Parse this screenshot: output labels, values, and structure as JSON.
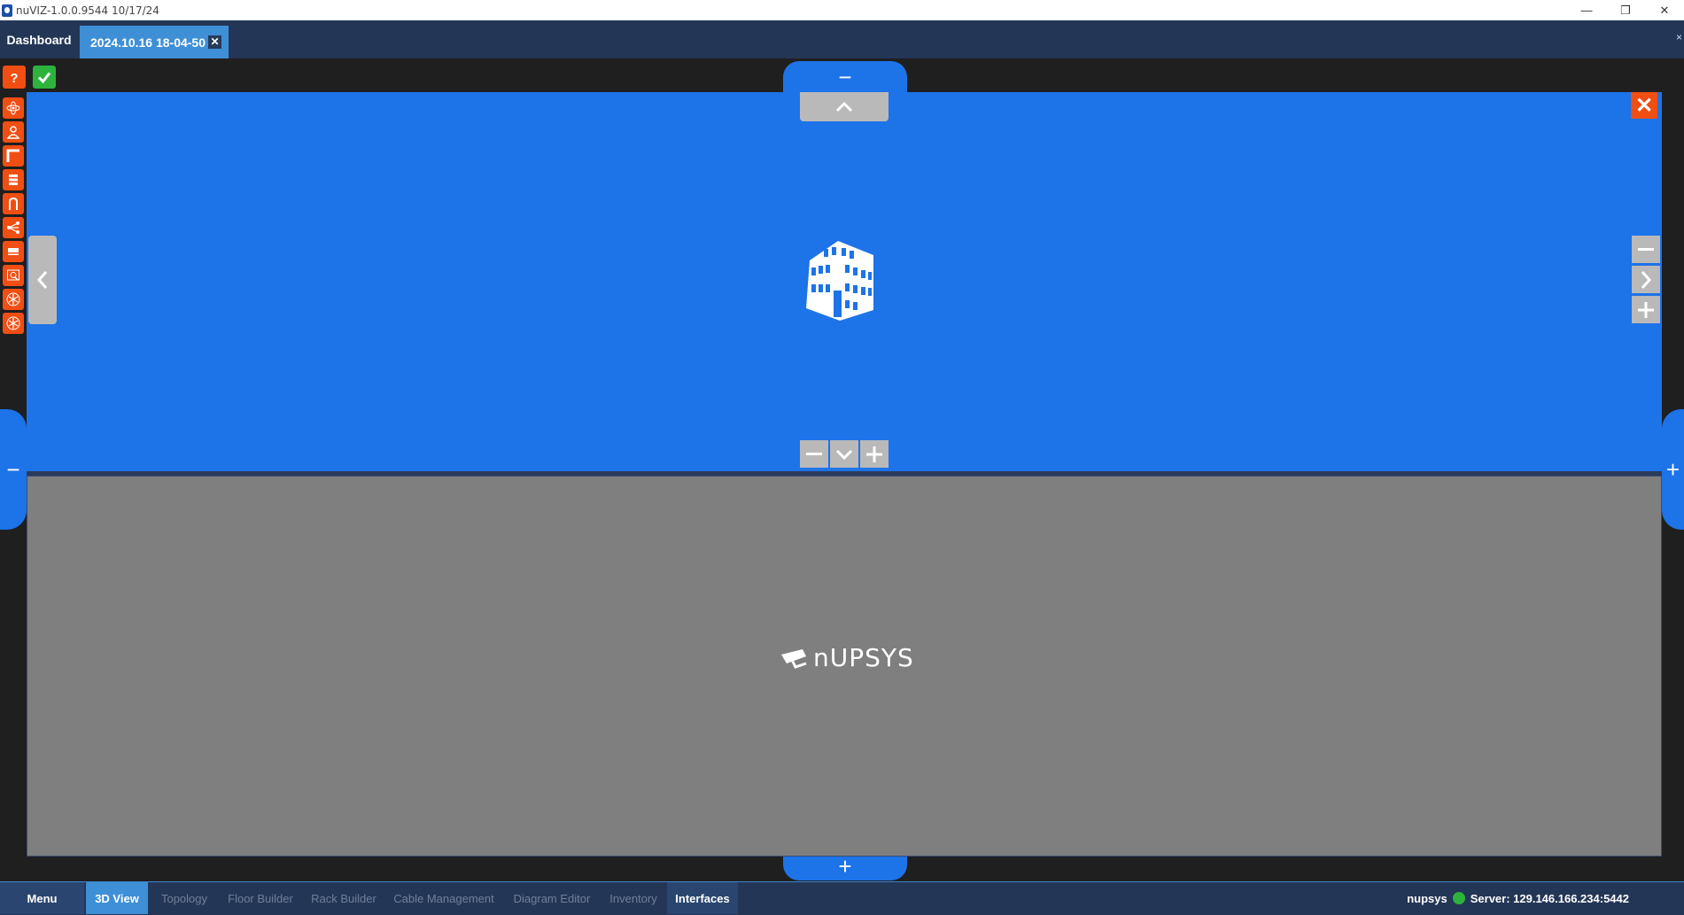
{
  "window": {
    "title": "nuVIZ-1.0.0.9544 10/17/24",
    "minimize_glyph": "—",
    "restore_glyph": "❐",
    "close_glyph": "✕"
  },
  "tabs": {
    "dashboard_label": "Dashboard",
    "session_label": "2024.10.16 18-04-50",
    "session_close": "✕",
    "overflow_glyph": "×"
  },
  "toolbar": {
    "help_icon": "question-icon",
    "check_icon": "check-icon",
    "tools": [
      "atom-icon",
      "user-icon",
      "frame-icon",
      "rack-icon",
      "cable-icon",
      "topology-icon",
      "tray-icon",
      "inspect-icon",
      "snowflake-icon",
      "snowflake-icon"
    ]
  },
  "panels": {
    "top_pill": "−",
    "bottom_pill": "+",
    "left_pill": "−",
    "right_pill": "+",
    "collapse_up": "^",
    "close_panel": "✕",
    "zoom_out": "−",
    "zoom_in": "+",
    "side_minus": "−",
    "side_next": "›",
    "side_plus": "+",
    "side_prev": "‹",
    "center_icon": "building-icon",
    "logo_text": "nUPSYS"
  },
  "bottom_nav": {
    "menu": "Menu",
    "items": [
      "3D View",
      "Topology",
      "Floor Builder",
      "Rack Builder",
      "Cable Management",
      "Diagram Editor",
      "Inventory",
      "Interfaces"
    ],
    "active": "3D View",
    "user": "nupsys",
    "server": "Server: 129.146.166.234:5442"
  },
  "colors": {
    "accent_blue": "#1d73e8",
    "tool_orange": "#f04e13",
    "status_green": "#2db33c",
    "nav_bg": "#243656"
  }
}
